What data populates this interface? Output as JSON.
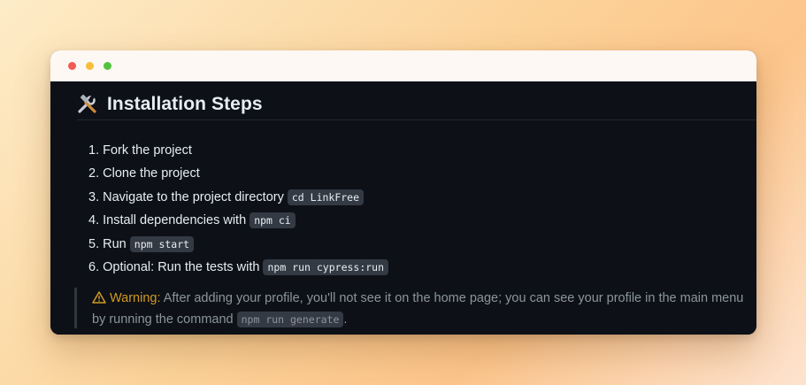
{
  "window": {
    "controls": [
      "close",
      "minimize",
      "maximize"
    ]
  },
  "heading": {
    "icon": "hammer-and-wrench-icon",
    "title": "Installation Steps"
  },
  "steps": [
    {
      "number": "1.",
      "text": "Fork the project",
      "code": ""
    },
    {
      "number": "2.",
      "text": "Clone the project",
      "code": ""
    },
    {
      "number": "3.",
      "text": "Navigate to the project directory",
      "code": "cd LinkFree"
    },
    {
      "number": "4.",
      "text": "Install dependencies with",
      "code": "npm ci"
    },
    {
      "number": "5.",
      "text": "Run",
      "code": "npm start"
    },
    {
      "number": "6.",
      "text": "Optional: Run the tests with",
      "code": "npm run cypress:run"
    }
  ],
  "warning": {
    "icon": "warning-icon",
    "title": "Warning:",
    "text": "After adding your profile, you'll not see it on the home page; you can see your profile in the main menu by running the command",
    "code": "npm run generate",
    "end": "."
  },
  "colors": {
    "background": "#0d1117",
    "text": "#e6edf3",
    "muted": "#8b949e",
    "warning": "#d29922",
    "code_bg": "#343a43"
  }
}
